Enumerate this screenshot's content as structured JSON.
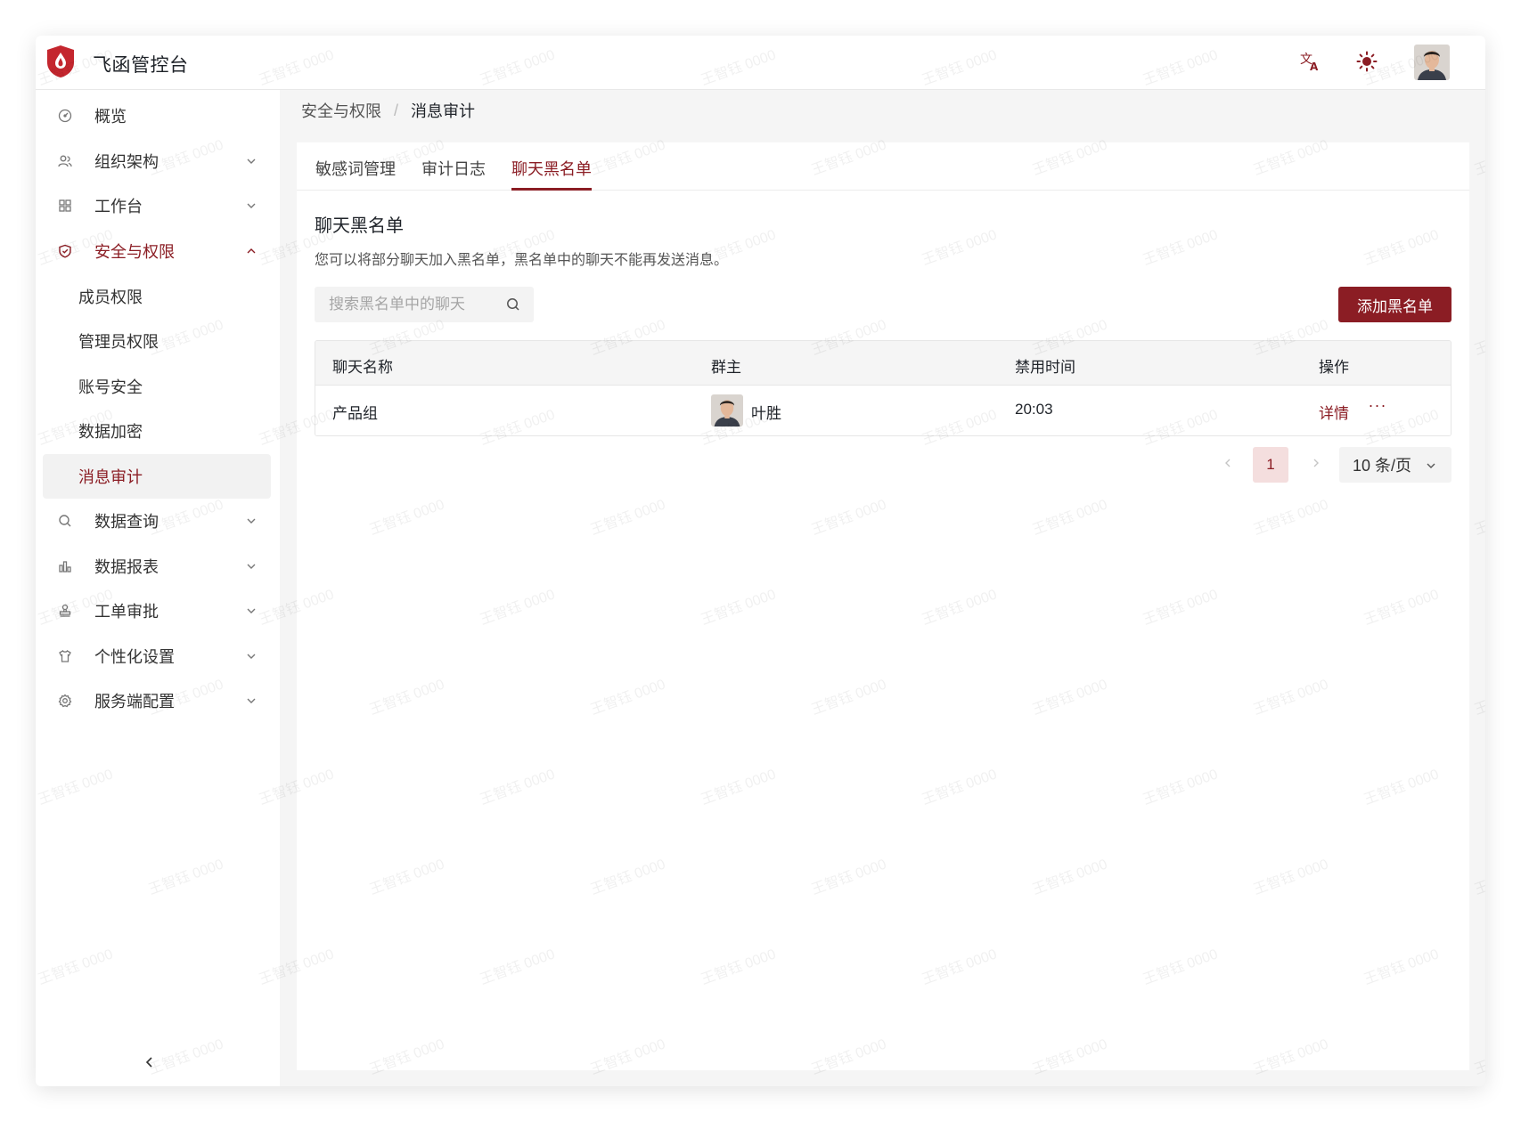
{
  "app": {
    "title": "飞函管控台",
    "brand_color": "#8b1d24"
  },
  "header": {
    "translate_icon": "translate-icon",
    "theme_icon": "sun-icon",
    "avatar": "user-avatar"
  },
  "sidebar": {
    "items": [
      {
        "label": "概览",
        "icon": "dashboard-icon"
      },
      {
        "label": "组织架构",
        "icon": "users-icon"
      },
      {
        "label": "工作台",
        "icon": "grid-icon"
      },
      {
        "label": "安全与权限",
        "icon": "shield-icon"
      },
      {
        "label": "数据查询",
        "icon": "search-icon"
      },
      {
        "label": "数据报表",
        "icon": "bar-chart-icon"
      },
      {
        "label": "工单审批",
        "icon": "stamp-icon"
      },
      {
        "label": "个性化设置",
        "icon": "shirt-icon"
      },
      {
        "label": "服务端配置",
        "icon": "gear-icon"
      }
    ],
    "security_subitems": [
      "成员权限",
      "管理员权限",
      "账号安全",
      "数据加密",
      "消息审计"
    ]
  },
  "breadcrumb": {
    "parent": "安全与权限",
    "separator": "/",
    "current": "消息审计"
  },
  "tabs": [
    "敏感词管理",
    "审计日志",
    "聊天黑名单"
  ],
  "section": {
    "title": "聊天黑名单",
    "description": "您可以将部分聊天加入黑名单，黑名单中的聊天不能再发送消息。"
  },
  "search": {
    "placeholder": "搜索黑名单中的聊天",
    "value": ""
  },
  "add_button": "添加黑名单",
  "table": {
    "columns": [
      "聊天名称",
      "群主",
      "禁用时间",
      "操作"
    ],
    "rows": [
      {
        "name": "产品组",
        "owner": "叶胜",
        "time": "20:03",
        "action": "详情",
        "more": "···"
      }
    ]
  },
  "pagination": {
    "current": "1",
    "page_size": "10 条/页"
  },
  "watermark": "王智钰 0000"
}
